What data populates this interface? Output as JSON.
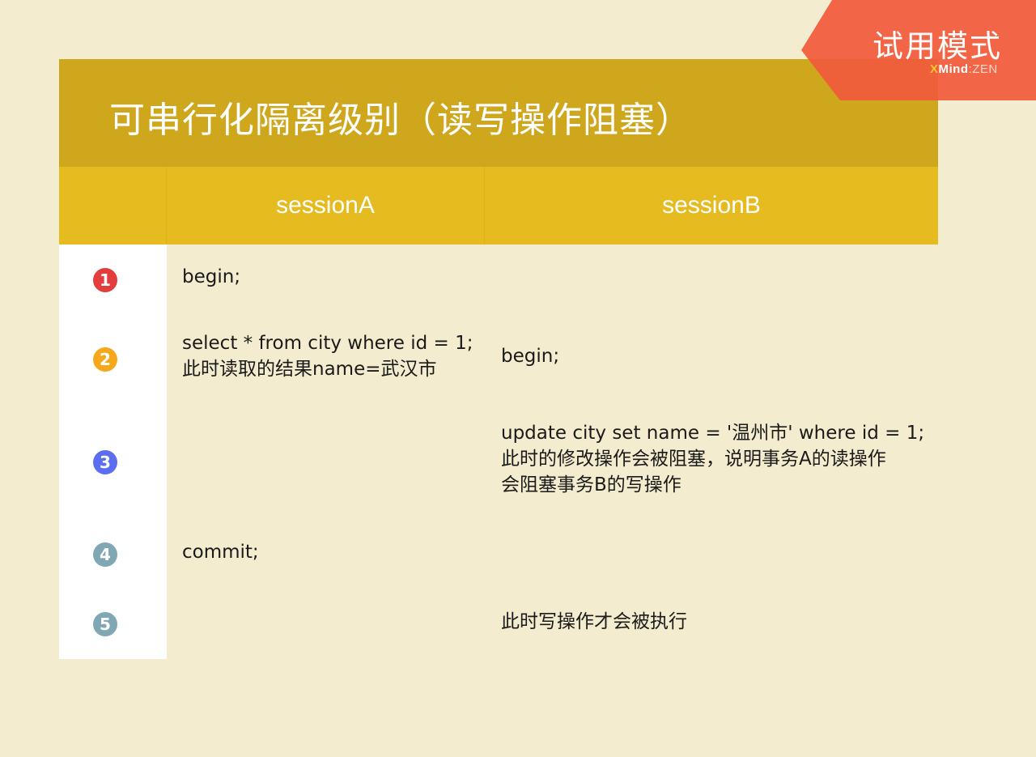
{
  "title": "可串行化隔离级别（读写操作阻塞）",
  "watermark": {
    "label": "试用模式",
    "brand_x": "X",
    "brand_mind": "Mind",
    "brand_sep": ":",
    "brand_zen": "ZEN"
  },
  "columns": {
    "a": "sessionA",
    "b": "sessionB"
  },
  "steps": [
    {
      "badge": "1",
      "color": "#e43d3d",
      "a": [
        "begin;"
      ],
      "b": []
    },
    {
      "badge": "2",
      "color": "#f5a81c",
      "a": [
        "select * from city where id = 1;",
        "此时读取的结果name=武汉市"
      ],
      "b": [
        "begin;"
      ]
    },
    {
      "badge": "3",
      "color": "#5b6ef2",
      "a": [],
      "b": [
        "update city set name = '温州市'  where id = 1;",
        "此时的修改操作会被阻塞，说明事务A的读操作",
        "会阻塞事务B的写操作"
      ]
    },
    {
      "badge": "4",
      "color": "#7fa8b4",
      "a": [
        "commit;"
      ],
      "b": []
    },
    {
      "badge": "5",
      "color": "#7fa8b4",
      "a": [],
      "b": [
        "此时写操作才会被执行"
      ]
    }
  ],
  "colors": {
    "background": "#f4ecce",
    "title_bar": "#cfa71c",
    "header_row": "#e6bb1f",
    "trial_tag": "#f15a3c"
  }
}
